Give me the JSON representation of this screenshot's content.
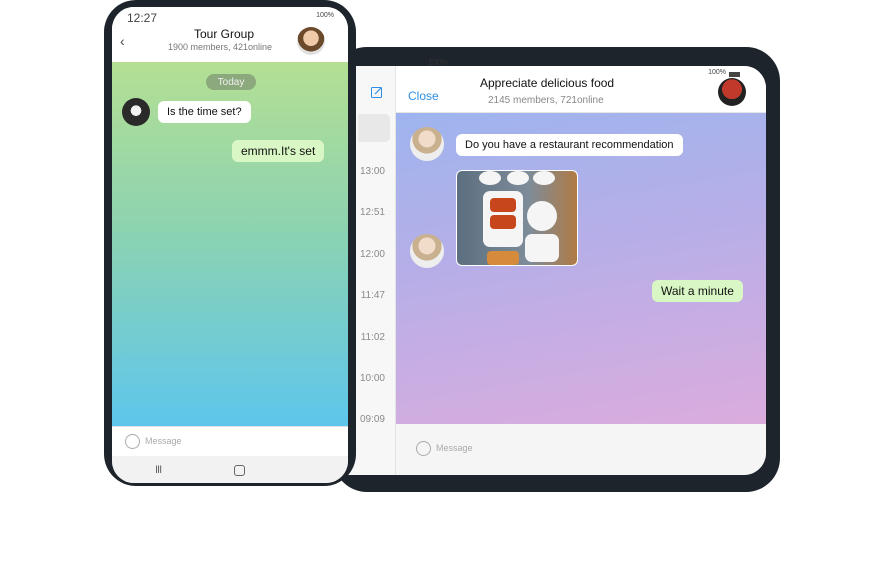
{
  "tablet": {
    "top_status": "100%",
    "sidebar_times": [
      "13:00",
      "12:51",
      "12:00",
      "11:47",
      "11:02",
      "10:00",
      "09:09"
    ],
    "chat": {
      "close_label": "Close",
      "title": "Appreciate delicious food",
      "subtitle": "2145 members, 721online",
      "status": "100%",
      "messages": [
        {
          "side": "incoming",
          "text": "Do you have a restaurant recommendation"
        },
        {
          "side": "outgoing",
          "text": "Wait a minute"
        }
      ],
      "input_placeholder": "Message"
    }
  },
  "phone": {
    "time": "12:27",
    "status": "100%",
    "title": "Tour Group",
    "subtitle": "1900 members, 421online",
    "date_separator": "Today",
    "messages": [
      {
        "side": "incoming",
        "text": "Is the time set?"
      },
      {
        "side": "outgoing",
        "text": "emmm.It's set"
      }
    ],
    "input_placeholder": "Message"
  },
  "colors": {
    "accent": "#2d8fe3",
    "outgoing_bubble": "#d9f7c5",
    "device_frame": "#1d242b"
  },
  "icons": [
    "chevron-left-icon",
    "compose-icon",
    "emoji-icon",
    "signal-icon",
    "battery-icon",
    "recent-apps-icon",
    "home-icon"
  ]
}
